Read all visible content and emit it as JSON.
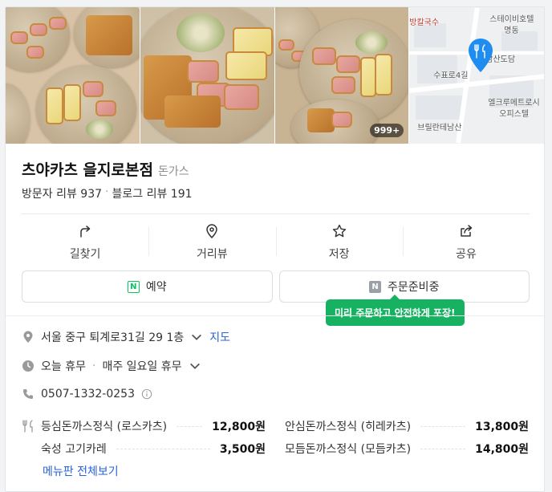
{
  "place": {
    "name": "츠야카츠 을지로본점",
    "category": "돈가스",
    "visitor_reviews": "방문자 리뷰 937",
    "blog_reviews": "블로그 리뷰 191"
  },
  "photos": {
    "count_badge": "999+"
  },
  "map": {
    "labels": [
      "방칼국수",
      "스테이비호텔",
      "명동",
      "남산도담",
      "수표로4길",
      "엘크루메트로시",
      "오피스텔",
      "브릴란테남산"
    ]
  },
  "actions": [
    {
      "label": "길찾기",
      "icon": "directions-icon"
    },
    {
      "label": "거리뷰",
      "icon": "location-pin-icon"
    },
    {
      "label": "저장",
      "icon": "star-icon"
    },
    {
      "label": "공유",
      "icon": "share-icon"
    }
  ],
  "buttons": {
    "reserve": "예약",
    "order": "주문준비중"
  },
  "tooltip": "미리 주문하고 안전하게 포장!",
  "info": {
    "address": "서울 중구 퇴계로31길 29 1층",
    "map_link": "지도",
    "status": "오늘 휴무",
    "hours": "매주 일요일 휴무",
    "phone": "0507-1332-0253"
  },
  "menu": {
    "items": [
      {
        "name": "등심돈까스정식 (로스카츠)",
        "price": "12,800원"
      },
      {
        "name": "안심돈까스정식 (히레카츠)",
        "price": "13,800원"
      },
      {
        "name": "숙성 고기카레",
        "price": "3,500원"
      },
      {
        "name": "모듬돈까스정식 (모듬카츠)",
        "price": "14,800원"
      }
    ],
    "more": "메뉴판 전체보기"
  },
  "colors": {
    "naver_green": "#03c75a",
    "tooltip_green": "#16b261",
    "link_blue": "#2a62d8",
    "pin_blue": "#1f8cf0"
  }
}
